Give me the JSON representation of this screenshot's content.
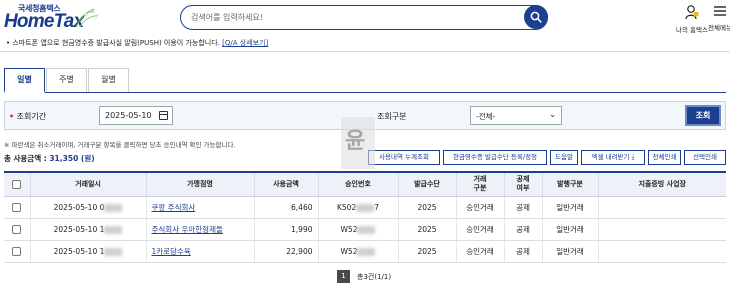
{
  "header": {
    "logo_sub": "국세청홈택스",
    "logo_main": "HomeTax",
    "search_placeholder": "검색어를 입력하세요!",
    "my_hometax": "나의 홈택스",
    "all_menu": "전체메뉴"
  },
  "notice": {
    "text": "• 스마트폰 앱으로 현금영수증 발급사실 알림(PUSH) 이용이 가능합니다.",
    "link": "[Q/A 상세보기]"
  },
  "tabs": [
    {
      "label": "일별",
      "active": true
    },
    {
      "label": "주별",
      "active": false
    },
    {
      "label": "월별",
      "active": false
    }
  ],
  "query": {
    "period_label": "조회기간",
    "date_value": "2025-05-10",
    "type_label": "조회구분",
    "type_selected": "-전체-",
    "search_button": "조회"
  },
  "info": {
    "text": "※ 파란색은 취소거래이며, 거래구분 항목을 클릭하면 당초 승인내역 확인 가능합니다.",
    "total_label": "총 사용금액 : ",
    "total_amount": "31,350 (원)"
  },
  "buttons": [
    "사용내역 누계조회",
    "현금영수증 발급수단 등록/정정",
    "도움말",
    "엑셀 내려받기",
    "전체인쇄",
    "선택인쇄"
  ],
  "table": {
    "headers": [
      "",
      "거래일시",
      "가맹점명",
      "사용금액",
      "승인번호",
      "발급수단",
      "거래\n구분",
      "공제\n여부",
      "발행구분",
      "지출증빙 사업장"
    ],
    "rows": [
      {
        "datetime": "2025-05-10 0",
        "merchant": "쿠팡 주식회사",
        "amount": "6,460",
        "approval": "K502",
        "approval_tail": "7",
        "means": "2025",
        "trade": "승인거래",
        "deduct": "공제",
        "issue": "일반거래",
        "biz": ""
      },
      {
        "datetime": "2025-05-10 1",
        "merchant": "주식회사 우아한형제들",
        "amount": "1,990",
        "approval": "W52",
        "approval_tail": "",
        "means": "2025",
        "trade": "승인거래",
        "deduct": "공제",
        "issue": "일반거래",
        "biz": ""
      },
      {
        "datetime": "2025-05-10 1",
        "merchant": "1카로당수육",
        "amount": "22,900",
        "approval": "W52",
        "approval_tail": "",
        "means": "2025",
        "trade": "승인거래",
        "deduct": "공제",
        "issue": "일반거래",
        "biz": ""
      }
    ]
  },
  "pager": {
    "current": "1",
    "total": "총3건(1/1)"
  },
  "watermark": "윤"
}
